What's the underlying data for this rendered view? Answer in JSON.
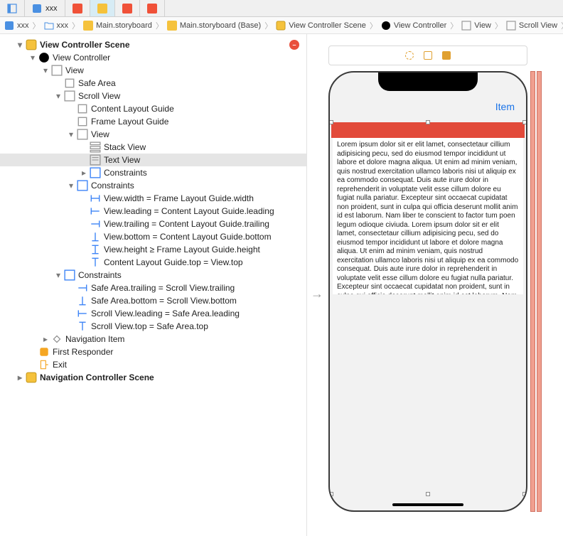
{
  "tabs": [
    {
      "label": "",
      "icon": "nav-icon"
    },
    {
      "label": "xxx",
      "icon": "project-icon"
    },
    {
      "label": "",
      "icon": "swift-icon"
    },
    {
      "label": "",
      "icon": "storyboard-icon",
      "active": true
    },
    {
      "label": "",
      "icon": "swift-icon"
    },
    {
      "label": "",
      "icon": "swift-icon"
    }
  ],
  "breadcrumb": [
    {
      "label": "xxx",
      "icon": "project-icon"
    },
    {
      "label": "xxx",
      "icon": "folder-icon"
    },
    {
      "label": "Main.storyboard",
      "icon": "storyboard-icon"
    },
    {
      "label": "Main.storyboard (Base)",
      "icon": "storyboard-icon"
    },
    {
      "label": "View Controller Scene",
      "icon": "scene-icon"
    },
    {
      "label": "View Controller",
      "icon": "scene-icon"
    },
    {
      "label": "View",
      "icon": "view-icon"
    },
    {
      "label": "Scroll View",
      "icon": "view-icon"
    }
  ],
  "outline": {
    "scene1": "View Controller Scene",
    "vc": "View Controller",
    "view": "View",
    "safe": "Safe Area",
    "scroll": "Scroll View",
    "clg": "Content Layout Guide",
    "flg": "Frame Layout Guide",
    "innerview": "View",
    "stack": "Stack View",
    "text": "Text View",
    "constraints": "Constraints",
    "c_width": "View.width = Frame Layout Guide.width",
    "c_leading": "View.leading = Content Layout Guide.leading",
    "c_trailing": "View.trailing = Content Layout Guide.trailing",
    "c_bottom": "View.bottom = Content Layout Guide.bottom",
    "c_height": "View.height ≥ Frame Layout Guide.height",
    "c_top": "Content Layout Guide.top = View.top",
    "outer_constraints": "Constraints",
    "oc1": "Safe Area.trailing = Scroll View.trailing",
    "oc2": "Safe Area.bottom = Scroll View.bottom",
    "oc3": "Scroll View.leading = Safe Area.leading",
    "oc4": "Scroll View.top = Safe Area.top",
    "navitem": "Navigation Item",
    "first": "First Responder",
    "exit": "Exit",
    "scene2": "Navigation Controller Scene"
  },
  "device": {
    "nav_item": "Item",
    "lorem": "Lorem ipsum dolor sit er elit lamet, consectetaur cillium adipisicing pecu, sed do eiusmod tempor incididunt ut labore et dolore magna aliqua. Ut enim ad minim veniam, quis nostrud exercitation ullamco laboris nisi ut aliquip ex ea commodo consequat. Duis aute irure dolor in reprehenderit in voluptate velit esse cillum dolore eu fugiat nulla pariatur. Excepteur sint occaecat cupidatat non proident, sunt in culpa qui officia deserunt mollit anim id est laborum. Nam liber te conscient to factor tum poen legum odioque civiuda. Lorem ipsum dolor sit er elit lamet, consectetaur cillium adipisicing pecu, sed do eiusmod tempor incididunt ut labore et dolore magna aliqua. Ut enim ad minim veniam, quis nostrud exercitation ullamco laboris nisi ut aliquip ex ea commodo consequat. Duis aute irure dolor in reprehenderit in voluptate velit esse cillum dolore eu fugiat nulla pariatur. Excepteur sint occaecat cupidatat non proident, sunt in culpa qui officia deserunt mollit anim id est laborum. Nam liber te conscient to factor tum poen legum odioque civiuda. id est laborum. Nam liber te conscient to factor tum poen legum"
  }
}
